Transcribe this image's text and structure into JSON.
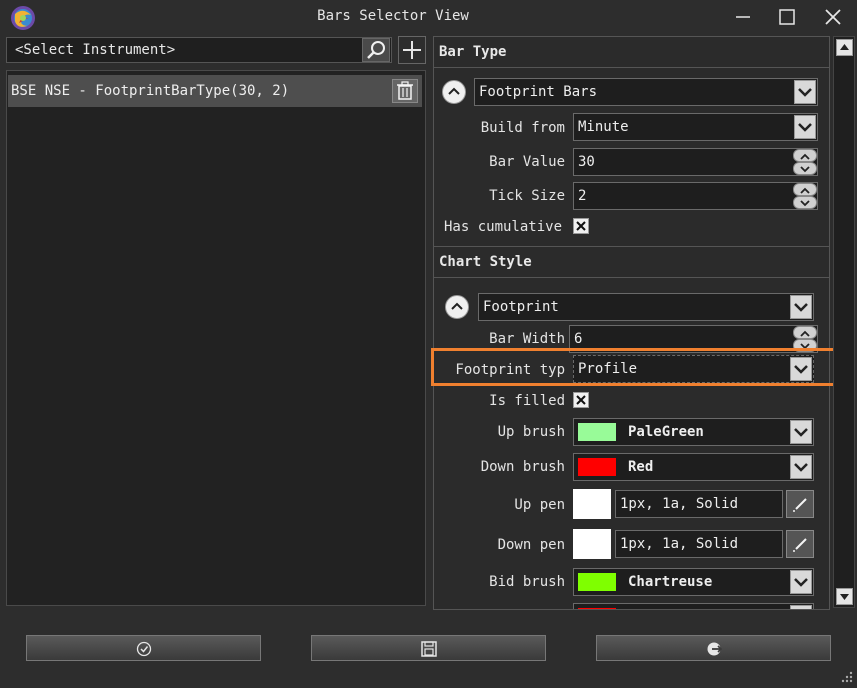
{
  "window": {
    "title": "Bars Selector View"
  },
  "instrument": {
    "selector_text": "<Select Instrument>"
  },
  "bars_list": {
    "items": [
      {
        "label": "BSE NSE - FootprintBarType(30, 2)"
      }
    ]
  },
  "bar_type": {
    "header": "Bar Type",
    "type_value": "Footprint Bars",
    "build_from_label": "Build from",
    "build_from_value": "Minute",
    "bar_value_label": "Bar Value",
    "bar_value_value": "30",
    "tick_size_label": "Tick Size",
    "tick_size_value": "2",
    "cumulative_label": "Has cumulative"
  },
  "chart_style": {
    "header": "Chart Style",
    "style_value": "Footprint",
    "bar_width_label": "Bar Width",
    "bar_width_value": "6",
    "footprint_type_label": "Footprint typ",
    "footprint_type_value": "Profile",
    "is_filled_label": "Is filled",
    "up_brush_label": "Up brush",
    "up_brush_value": "PaleGreen",
    "up_brush_color": "#98fb98",
    "down_brush_label": "Down brush",
    "down_brush_value": "Red",
    "down_brush_color": "#ff0000",
    "up_pen_label": "Up pen",
    "up_pen_value": "1px, 1a, Solid",
    "down_pen_label": "Down pen",
    "down_pen_value": "1px, 1a, Solid",
    "bid_brush_label": "Bid brush",
    "bid_brush_value": "Chartreuse",
    "bid_brush_color": "#7fff00"
  },
  "colors": {
    "highlight": "#f0802f",
    "background": "#2d2d2d"
  }
}
